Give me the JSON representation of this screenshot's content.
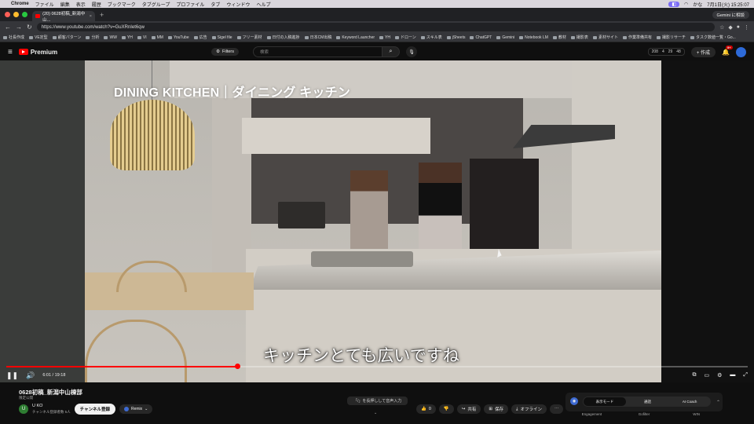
{
  "menubar": {
    "app": "Chrome",
    "items": [
      "ファイル",
      "編集",
      "表示",
      "履歴",
      "ブックマーク",
      "タブグループ",
      "プロファイル",
      "タブ",
      "ウィンドウ",
      "ヘルプ"
    ],
    "right": "7月1日(火)  15:25:07",
    "ime": "かな"
  },
  "browser": {
    "tab_title": "(20) 0628初稿_新潟中山...",
    "gemini": "Gemini に相談",
    "url": "https://www.youtube.com/watch?v=GuXRnIet6qw",
    "bookmarks": [
      "社長作成",
      "VE定型",
      "顧客パターン",
      "分析",
      "WW",
      "YH",
      "VI",
      "MM",
      "YouTube",
      "広告",
      "Sigel file",
      "フリー素材",
      "日付の入稿進捗",
      "日本CM出稿",
      "Keyword Launcher",
      "YH",
      "ドローン",
      "スキル表",
      "jSheets",
      "ChatGPT",
      "Gemini",
      "Notebook LM",
      "教材",
      "撮影表",
      "素材サイト",
      "作業準備共有",
      "撮影リサーチ",
      "タスク数値一覧・Go..."
    ]
  },
  "youtube": {
    "logo": "Premium",
    "filters": "Filters",
    "search_placeholder": "検索",
    "stats": [
      "208",
      "4",
      "29",
      "48"
    ],
    "create": "作成",
    "notifications": "9+"
  },
  "video": {
    "overlay_title": "DINING KITCHEN｜ダイニング キッチン",
    "subtitle": "キッチンとても広いですね",
    "current_time": "6:01",
    "duration": "19:18",
    "progress": 0.311
  },
  "info": {
    "title": "0628初稿_新潟中山棟部",
    "visibility": "限定公開",
    "channel": "U KO",
    "channel_initial": "U",
    "subscribers": "チャンネル登録者数 5人",
    "subscribe": "チャンネル登録",
    "remix": "Remix",
    "tip": "「/」を長押しして音声入力",
    "actions": {
      "like": "0",
      "share": "共有",
      "save": "保存",
      "offline": "オフライン"
    },
    "modes": [
      "表示モード",
      "通話",
      "AI Coach"
    ],
    "mode_labels": [
      "Engagement",
      "Gofilter",
      "WIN"
    ]
  },
  "colors": {
    "accent": "#ff0000",
    "background": "#0f0f0f"
  }
}
